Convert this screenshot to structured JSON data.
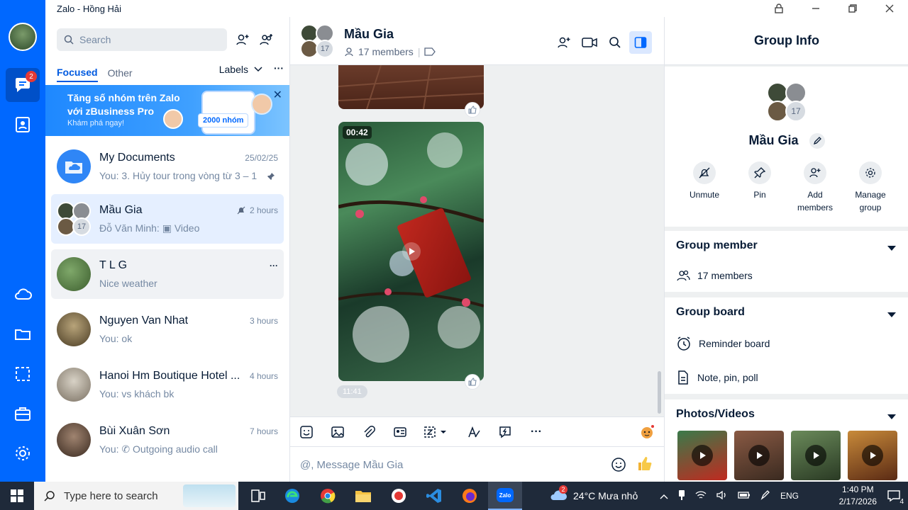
{
  "window": {
    "title": "Zalo - Hồng Hải"
  },
  "nav": {
    "messages_badge": "2"
  },
  "list": {
    "search_placeholder": "Search",
    "tabs": [
      "Focused",
      "Other"
    ],
    "labels": "Labels",
    "banner": {
      "line1": "Tăng số nhóm trên Zalo",
      "line2": "với zBusiness Pro",
      "cta": "Khám phá ngay!",
      "pill": "2000 nhóm"
    },
    "conversations": [
      {
        "name": "My Documents",
        "message": "You: 3. Hủy tour trong vòng từ 3 – 1",
        "time": "25/02/25"
      },
      {
        "name": "Mầu Gia",
        "message": "Đỗ Văn Minh: ▣ Video",
        "time": "2 hours",
        "count": "17"
      },
      {
        "name": "T L G",
        "message": "Nice weather",
        "time": "···"
      },
      {
        "name": "Nguyen Van Nhat",
        "message": "You: ok",
        "time": "3 hours"
      },
      {
        "name": "Hanoi Hm Boutique Hotel ...",
        "message": "You: vs khách bk",
        "time": "4 hours"
      },
      {
        "name": "Bùi Xuân Sơn",
        "message": "You: ✆ Outgoing audio call",
        "time": "7 hours"
      }
    ]
  },
  "chat": {
    "name": "Mầu Gia",
    "members": "17 members",
    "avatar_count": "17",
    "video_duration": "00:42",
    "timestamp": "11:41",
    "composer_placeholder": "@, Message Mầu Gia"
  },
  "info": {
    "header": "Group Info",
    "name": "Mầu Gia",
    "avatar_count": "17",
    "actions": [
      {
        "label": "Unmute",
        "icon": "bell-off-icon"
      },
      {
        "label": "Pin",
        "icon": "pin-icon"
      },
      {
        "label": "Add members",
        "icon": "add-user-icon"
      },
      {
        "label": "Manage group",
        "icon": "gear-icon"
      }
    ],
    "member_section": {
      "title": "Group member",
      "row": "17 members"
    },
    "board_section": {
      "title": "Group board",
      "rows": [
        "Reminder board",
        "Note, pin, poll"
      ]
    },
    "media_section": {
      "title": "Photos/Videos"
    }
  },
  "taskbar": {
    "search_placeholder": "Type here to search",
    "weather_badge": "2",
    "weather": "24°C  Mưa nhỏ",
    "lang": "ENG",
    "time": "1:40 PM",
    "date": "2/17/2026",
    "notif_count": "4"
  },
  "colors": {
    "brand": "#0068ff",
    "selected": "#e5efff",
    "badge": "#e53935"
  }
}
